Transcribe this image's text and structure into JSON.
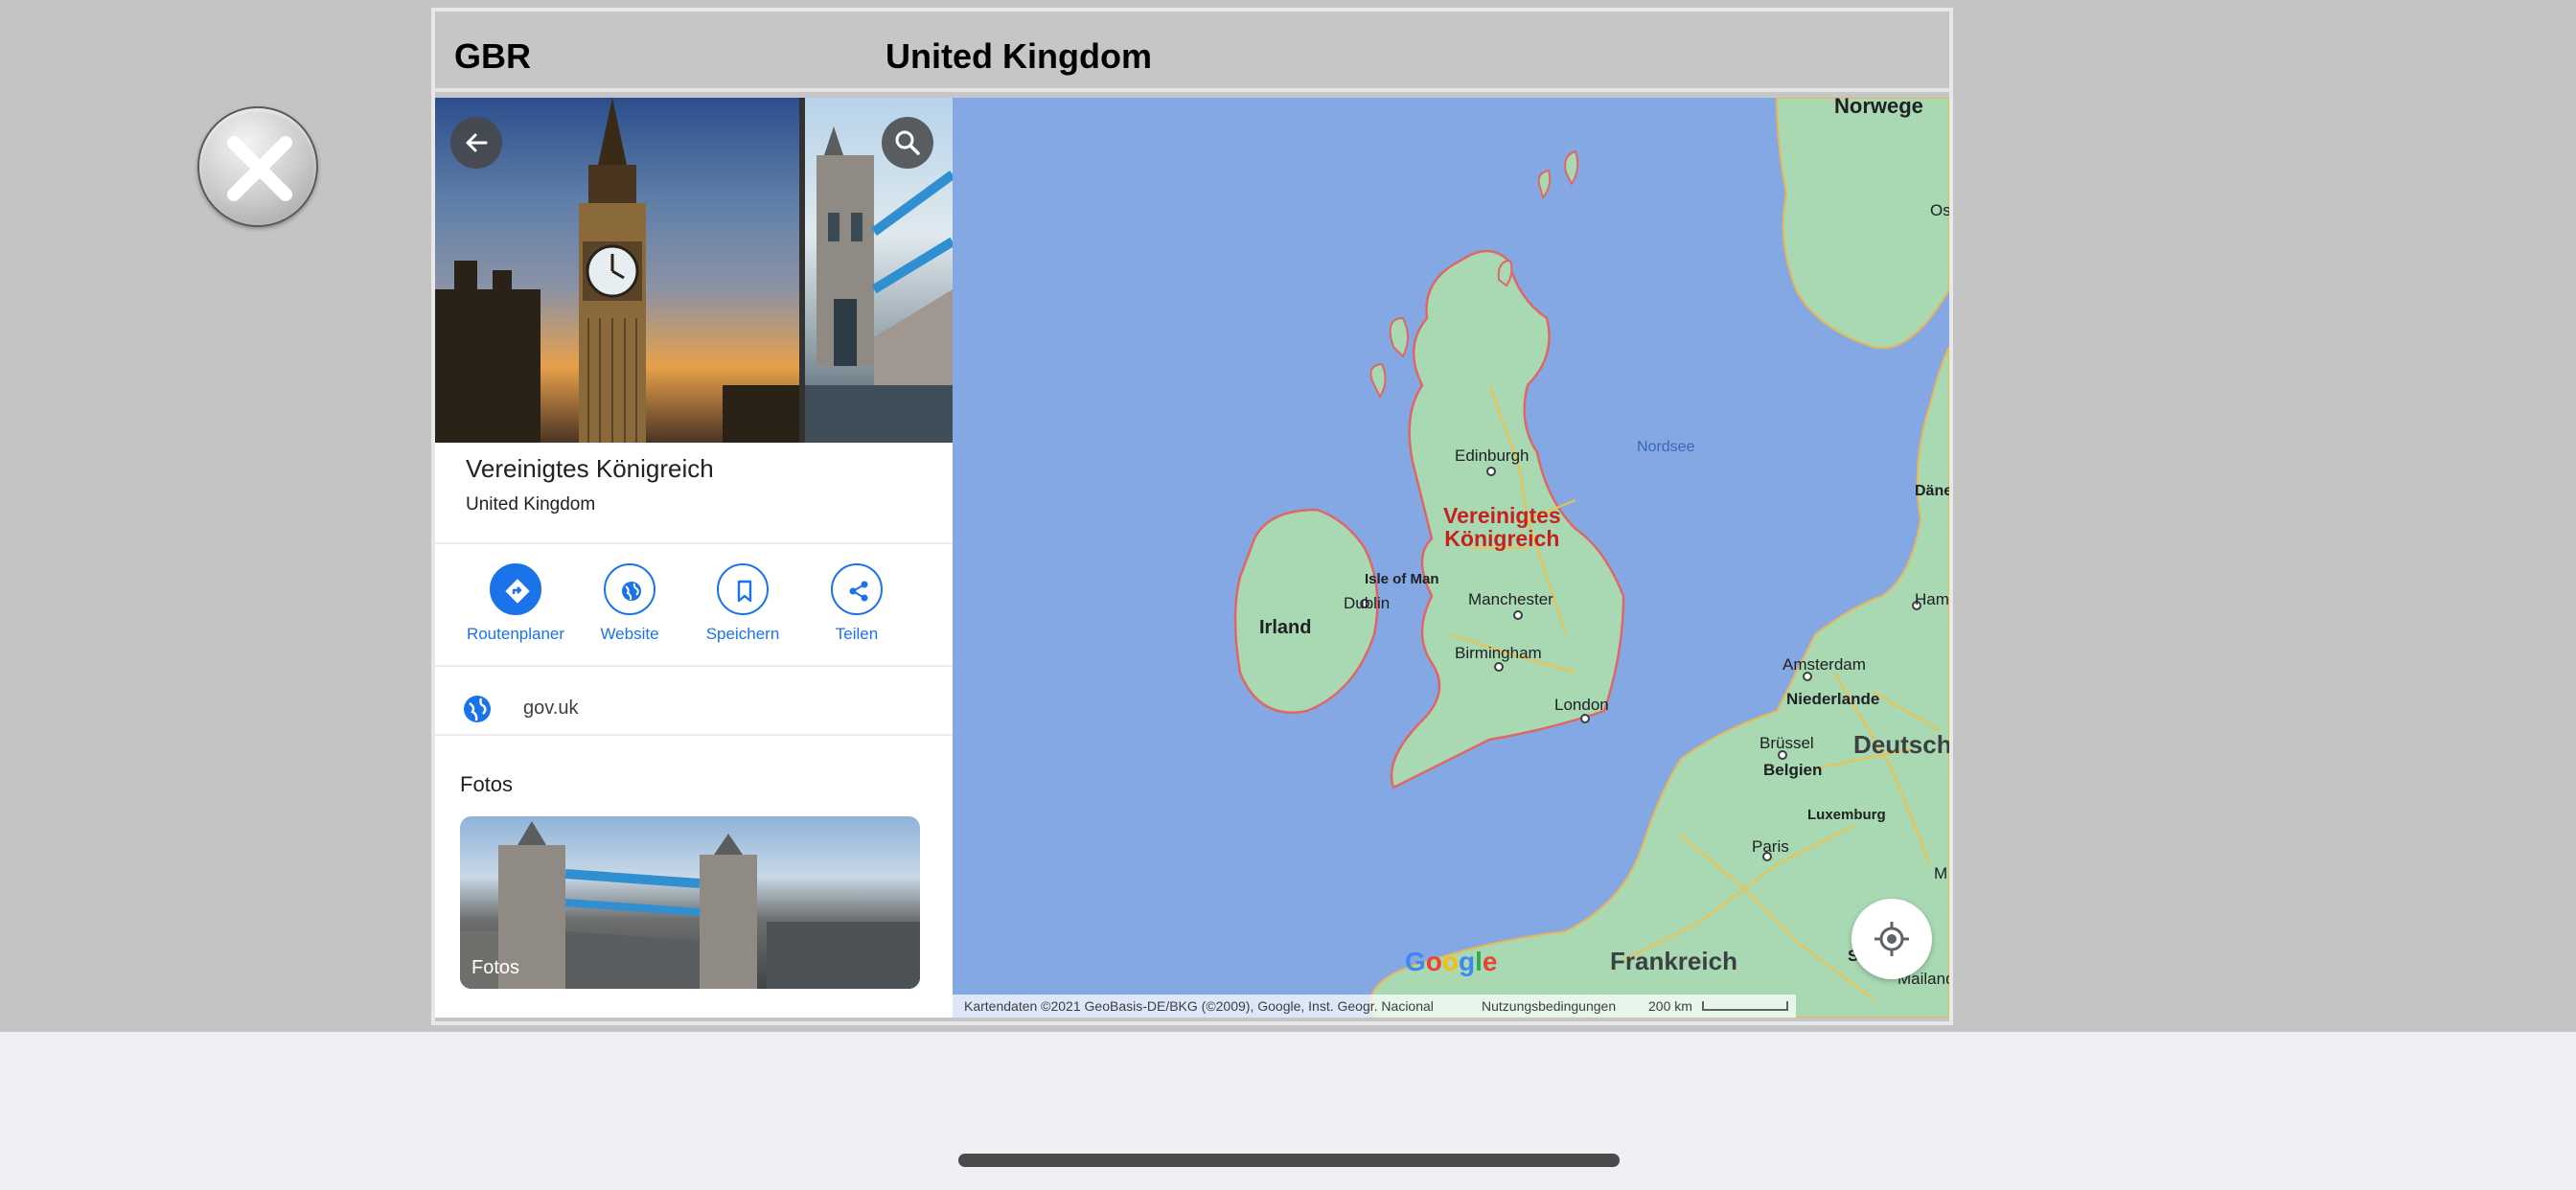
{
  "header": {
    "code": "GBR",
    "title": "United Kingdom"
  },
  "panel": {
    "place_name": "Vereinigtes Königreich",
    "place_subtitle": "United Kingdom",
    "actions": [
      {
        "label": "Routenplaner",
        "icon": "directions-icon"
      },
      {
        "label": "Website",
        "icon": "globe-icon"
      },
      {
        "label": "Speichern",
        "icon": "bookmark-icon"
      },
      {
        "label": "Teilen",
        "icon": "share-icon"
      }
    ],
    "website": "gov.uk",
    "photos_heading": "Fotos",
    "photos_card_label": "Fotos"
  },
  "map": {
    "labels": {
      "norwegen": "Norwege",
      "oslo": "Os",
      "edinburgh": "Edinburgh",
      "nordsee": "Nordsee",
      "daenemark": "Dänema",
      "uk_1": "Vereinigtes",
      "uk_2": "Königreich",
      "isle_of_man": "Isle of Man",
      "manchester": "Manchester",
      "hamburg": "Hamburg",
      "dublin": "Dublin",
      "irland": "Irland",
      "amsterdam": "Amsterdam",
      "birmingham": "Birmingham",
      "niederlande": "Niederlande",
      "london": "London",
      "bruessel": "Brüssel",
      "deutschland": "Deutschl",
      "belgien": "Belgien",
      "luxemburg": "Luxemburg",
      "paris": "Paris",
      "m": "M",
      "frankreich": "Frankreich",
      "sch": "Sch",
      "mailand": "Mailand"
    },
    "google": "Google",
    "footer": {
      "attribution": "Kartendaten ©2021 GeoBasis-DE/BKG (©2009), Google, Inst. Geogr. Nacional",
      "terms": "Nutzungsbedingungen",
      "scale": "200 km"
    }
  },
  "colors": {
    "accent": "#1a73e8",
    "water": "#84a8e4",
    "land": "#a8d9b3",
    "border_red": "#e06666",
    "window_gray": "#c6c6c6"
  }
}
